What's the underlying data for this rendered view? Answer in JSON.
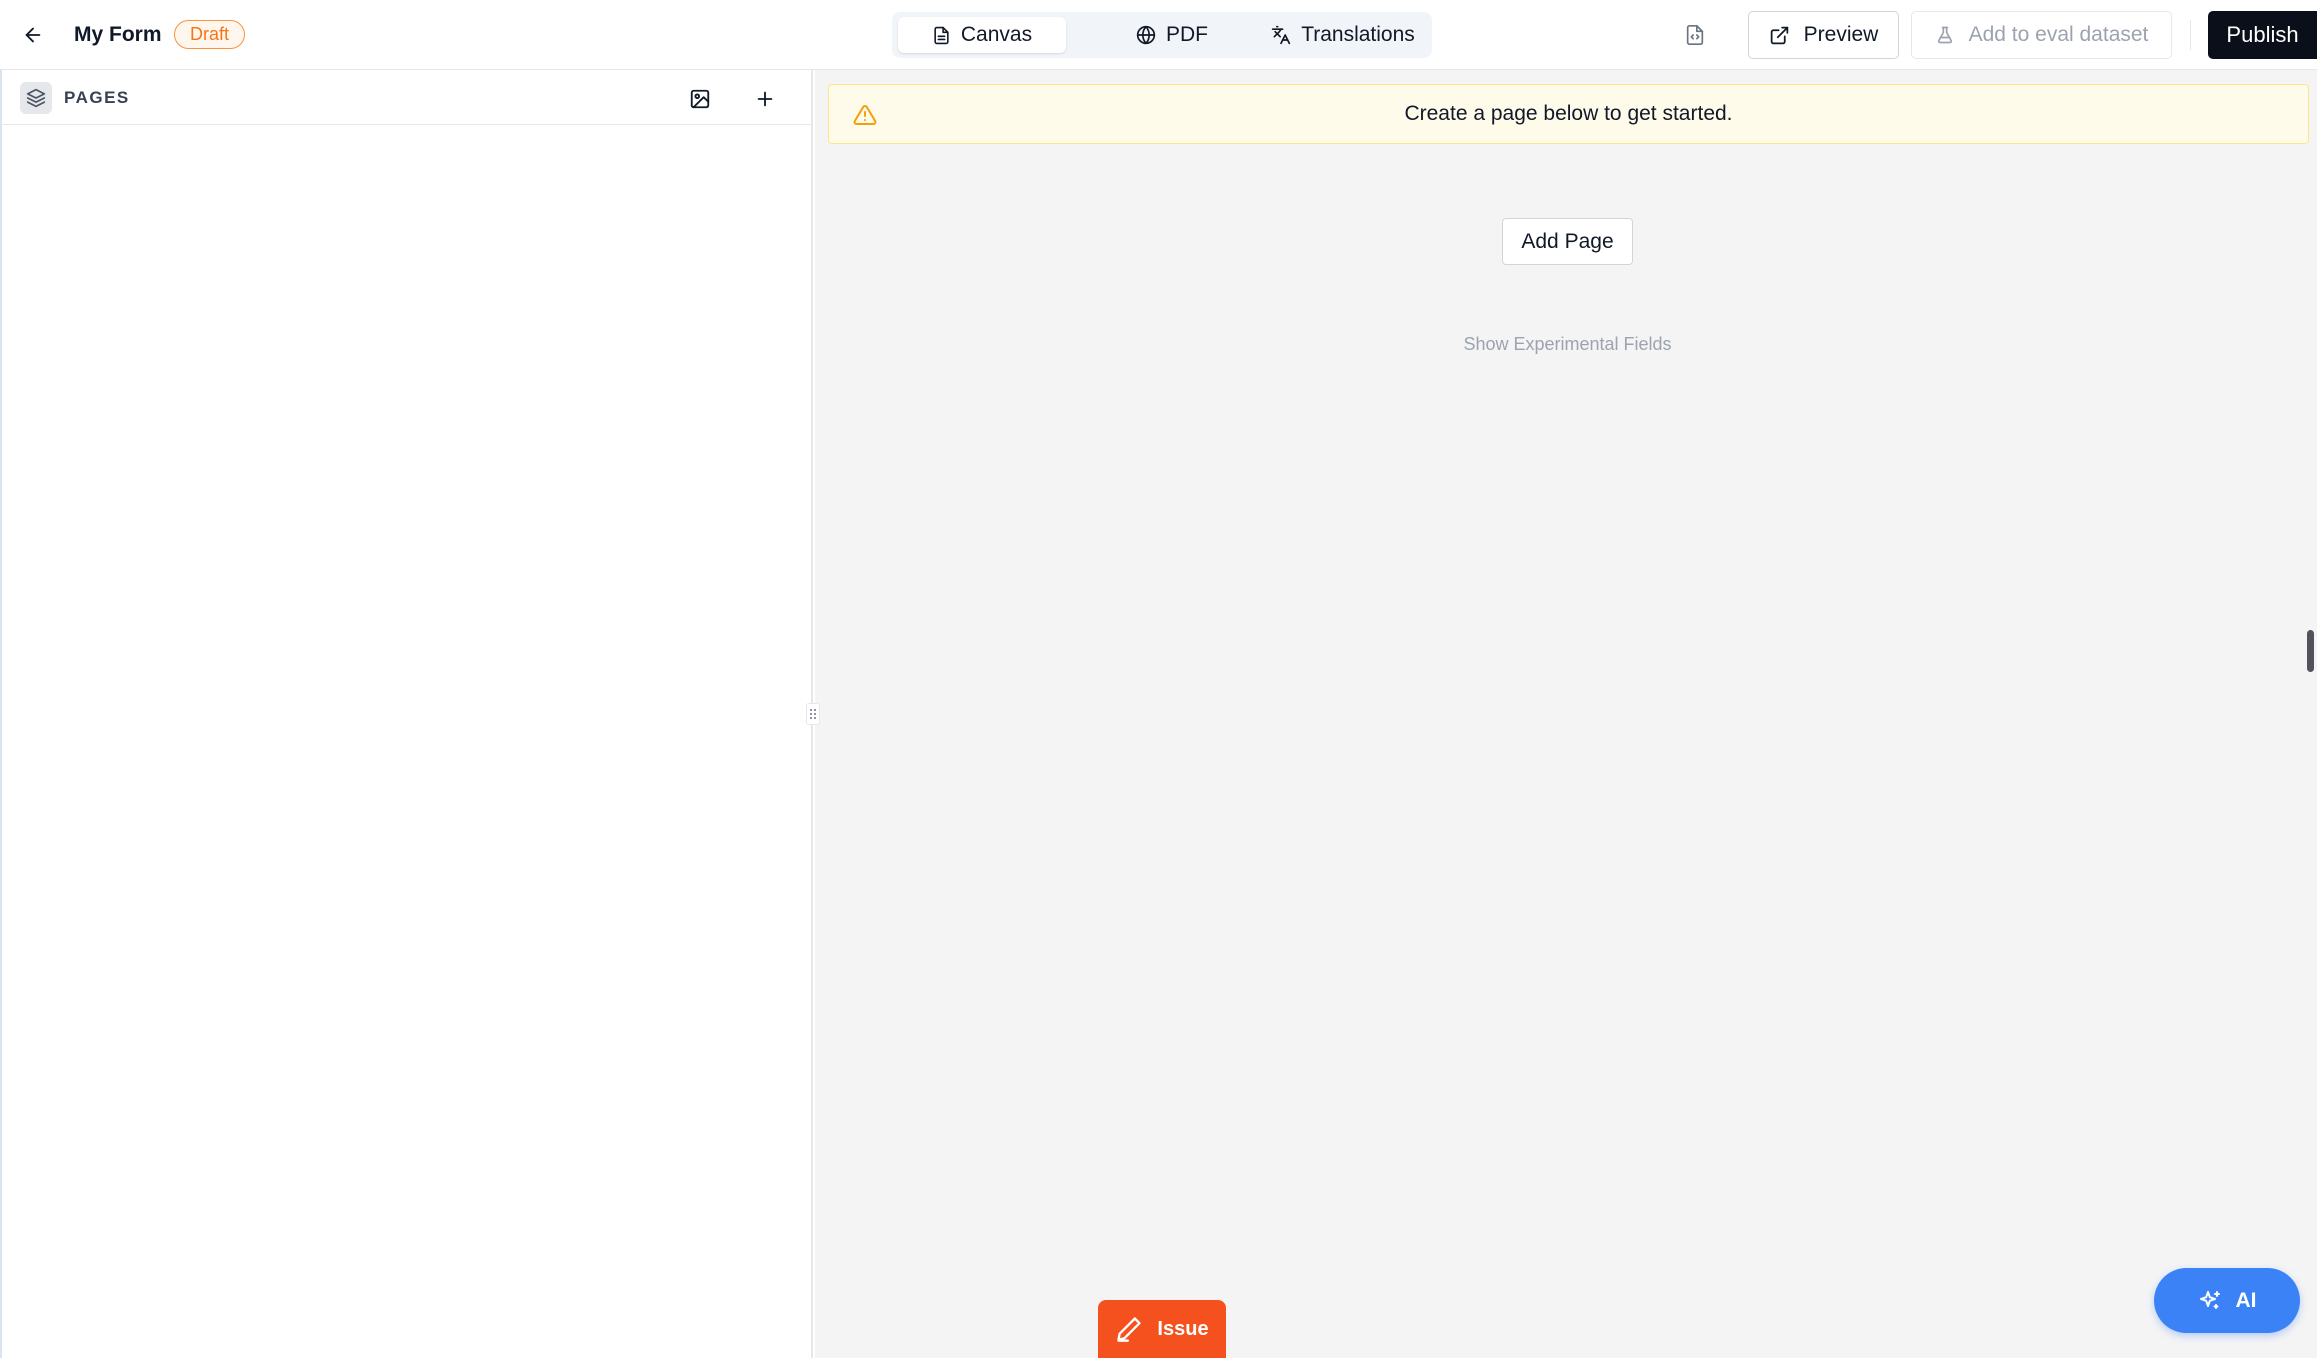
{
  "header": {
    "back_icon": "arrow-left-icon",
    "form_title": "My Form",
    "status_badge": "Draft",
    "tabs": [
      {
        "label": "Canvas",
        "icon": "file-text-icon",
        "active": true
      },
      {
        "label": "PDF",
        "icon": "globe-icon",
        "active": false
      },
      {
        "label": "Translations",
        "icon": "languages-icon",
        "active": false
      }
    ],
    "code_icon": "file-code-icon",
    "preview_label": "Preview",
    "eval_label": "Add to eval dataset",
    "publish_label": "Publish"
  },
  "sidebar": {
    "section_label": "PAGES",
    "layers_icon": "layers-icon",
    "image_icon": "image-icon",
    "add_icon": "plus-icon"
  },
  "main": {
    "banner_text": "Create a page below to get started.",
    "banner_icon": "warning-triangle-icon",
    "add_page_label": "Add Page",
    "experimental_label": "Show Experimental Fields"
  },
  "floating": {
    "issue_label": "Issue",
    "ai_label": "AI"
  },
  "colors": {
    "draft": "#f97316",
    "publish_bg": "#0b0f19",
    "banner_bg": "#fffbeb",
    "warning": "#f59e0b",
    "issue_bg": "#f4511e",
    "ai_bg": "#3b82f6",
    "canvas_bg": "#f4f4f5"
  }
}
